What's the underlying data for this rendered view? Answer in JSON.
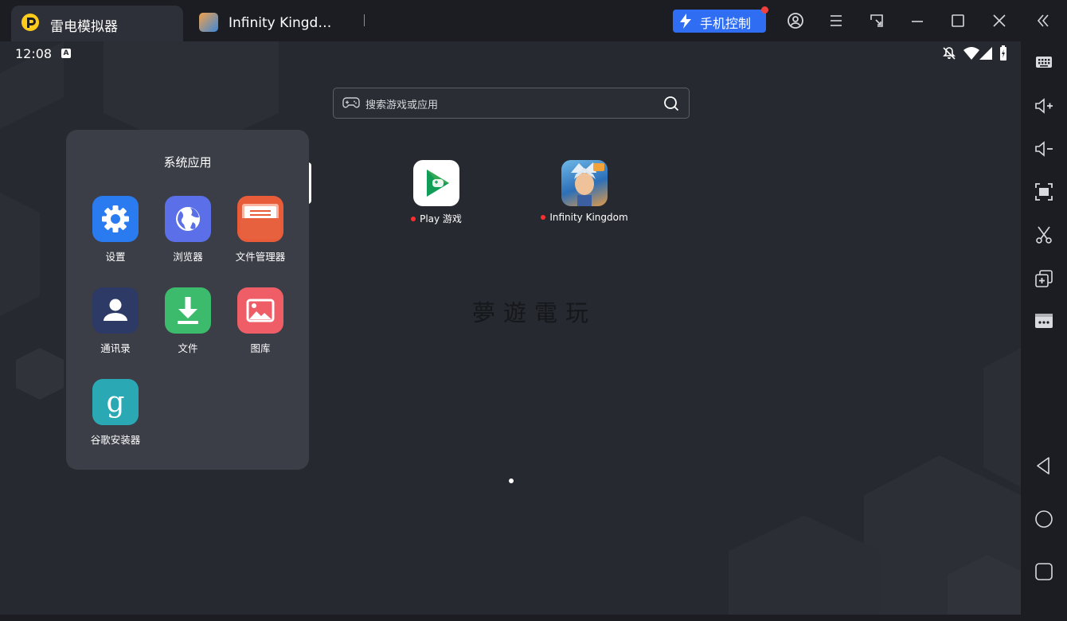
{
  "window": {
    "tabs": [
      {
        "label": "雷电模拟器",
        "icon": "ldplayer-logo-icon",
        "active": true
      },
      {
        "label": "Infinity Kingd…",
        "icon": "infinity-kingdom-icon",
        "active": false
      }
    ],
    "phone_control_label": "手机控制",
    "controls": [
      "account-icon",
      "menu-icon",
      "resize-icon",
      "minimize-icon",
      "maximize-icon",
      "close-icon",
      "collapse-icon"
    ]
  },
  "status_bar": {
    "time": "12:08",
    "badge": "A",
    "icons": [
      "notifications-off-icon",
      "wifi-icon",
      "signal-icon",
      "battery-icon"
    ]
  },
  "search": {
    "placeholder": "搜索游戏或应用"
  },
  "desktop_apps": [
    {
      "label": "Play 游戏",
      "icon": "play-games-icon",
      "new_dot": true
    },
    {
      "label": "Infinity Kingdom",
      "icon": "infinity-kingdom-icon",
      "new_dot": true
    }
  ],
  "folder": {
    "title": "系统应用",
    "apps": [
      {
        "label": "设置",
        "icon": "settings-icon",
        "color": "#2a7bef"
      },
      {
        "label": "浏览器",
        "icon": "browser-icon",
        "color": "#5b70e8"
      },
      {
        "label": "文件管理器",
        "icon": "file-manager-icon",
        "color": "#e85c3a"
      },
      {
        "label": "通讯录",
        "icon": "contacts-icon",
        "color": "#2e3a66"
      },
      {
        "label": "文件",
        "icon": "download-icon",
        "color": "#3dbb6c"
      },
      {
        "label": "图库",
        "icon": "gallery-icon",
        "color": "#ef5e66"
      },
      {
        "label": "谷歌安装器",
        "icon": "google-installer-icon",
        "color": "#2aa8b4"
      }
    ]
  },
  "watermark": "夢遊電玩",
  "sidebar_icons": [
    "keyboard-icon",
    "volume-up-icon",
    "volume-down-icon",
    "screenshot-icon",
    "scissors-icon",
    "multi-instance-icon",
    "more-icon",
    "back-icon",
    "home-icon",
    "recents-icon"
  ]
}
